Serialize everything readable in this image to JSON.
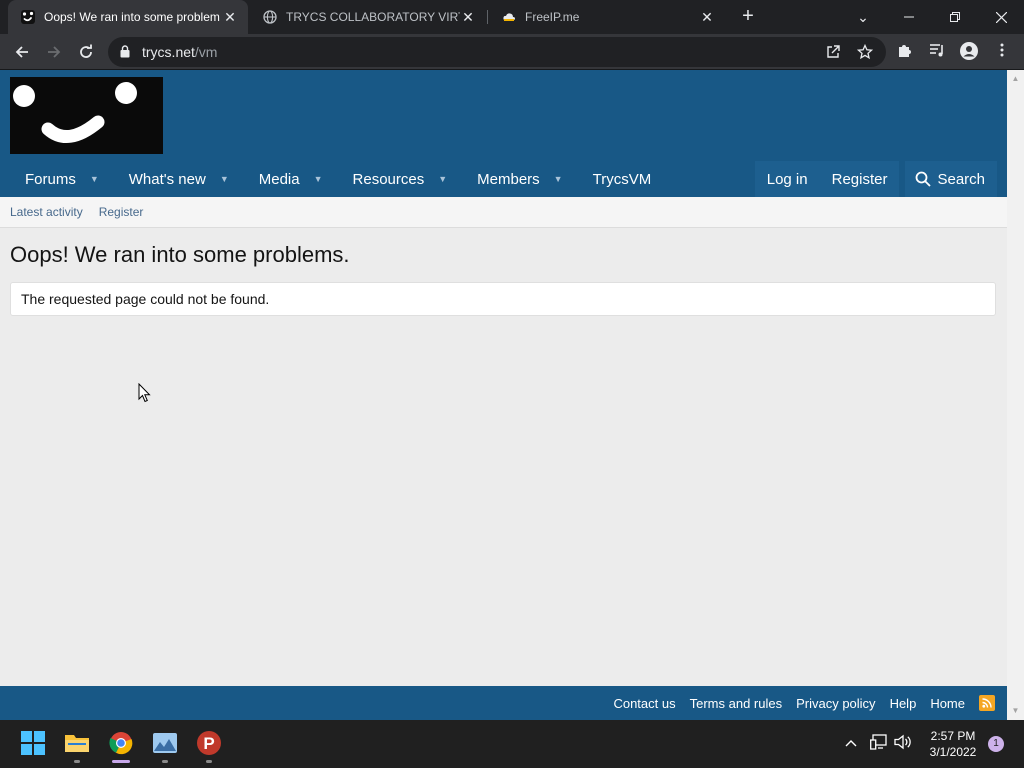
{
  "browser": {
    "tabs": [
      {
        "title": "Oops! We ran into some problem",
        "active": true,
        "close": "✕"
      },
      {
        "title": "TRYCS COLLABORATORY VIRTUA",
        "active": false,
        "close": "✕"
      },
      {
        "title": "FreeIP.me",
        "active": false,
        "close": "✕"
      }
    ],
    "new_tab": "+",
    "url_host": "trycs.net",
    "url_path": "/vm"
  },
  "site": {
    "nav": [
      {
        "label": "Forums",
        "has_menu": true
      },
      {
        "label": "What's new",
        "has_menu": true
      },
      {
        "label": "Media",
        "has_menu": true
      },
      {
        "label": "Resources",
        "has_menu": true
      },
      {
        "label": "Members",
        "has_menu": true
      },
      {
        "label": "TrycsVM",
        "has_menu": false
      }
    ],
    "login_label": "Log in",
    "register_label": "Register",
    "search_label": "Search",
    "subnav": [
      "Latest activity",
      "Register"
    ],
    "page_title": "Oops! We ran into some problems.",
    "message": "The requested page could not be found.",
    "footer_links": [
      "Contact us",
      "Terms and rules",
      "Privacy policy",
      "Help",
      "Home"
    ]
  },
  "taskbar": {
    "time": "2:57 PM",
    "date": "3/1/2022",
    "notifications": "1"
  },
  "colors": {
    "header": "#185886",
    "page_bg": "#ececec",
    "link": "#47698c"
  }
}
